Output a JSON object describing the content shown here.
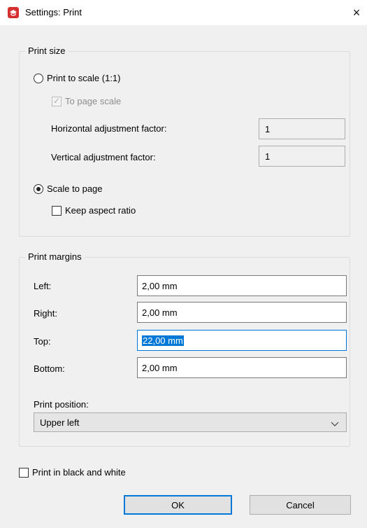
{
  "window": {
    "title": "Settings: Print",
    "close_symbol": "×"
  },
  "print_size": {
    "legend": "Print size",
    "print_to_scale_label": "Print to scale (1:1)",
    "to_page_scale_label": "To page scale",
    "horizontal_label": "Horizontal adjustment factor:",
    "horizontal_value": "1",
    "vertical_label": "Vertical adjustment factor:",
    "vertical_value": "1",
    "scale_to_page_label": "Scale to page",
    "keep_aspect_label": "Keep aspect ratio",
    "selected_option": "Scale to page",
    "to_page_scale_checked": true,
    "keep_aspect_checked": false
  },
  "print_margins": {
    "legend": "Print margins",
    "left_label": "Left:",
    "left_value": "2,00 mm",
    "right_label": "Right:",
    "right_value": "2,00 mm",
    "top_label": "Top:",
    "top_value": "22,00 mm",
    "bottom_label": "Bottom:",
    "bottom_value": "2,00 mm",
    "position_label": "Print position:",
    "position_value": "Upper left"
  },
  "bw": {
    "label": "Print in black and white",
    "checked": false
  },
  "buttons": {
    "ok": "OK",
    "cancel": "Cancel"
  },
  "colors": {
    "accent": "#0078d7",
    "app_icon": "#d62f2f"
  }
}
